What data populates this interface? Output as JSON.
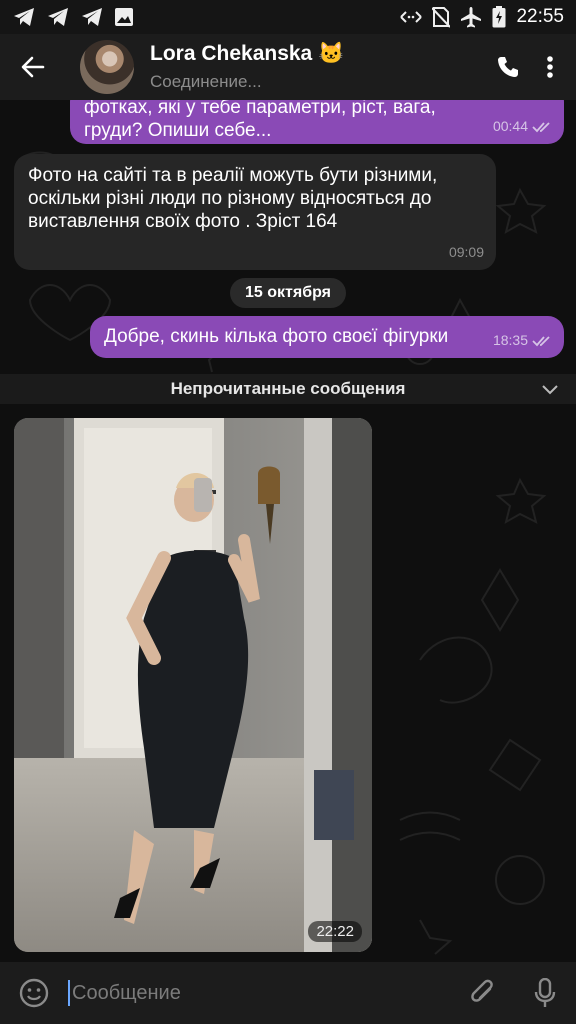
{
  "status_bar": {
    "time": "22:55",
    "left_icons": [
      "telegram-icon",
      "telegram-icon",
      "telegram-icon",
      "image-icon"
    ],
    "right_icons": [
      "data-sync-icon",
      "no-sim-icon",
      "airplane-mode-icon",
      "battery-charging-icon"
    ]
  },
  "header": {
    "name": "Lora Chekanska",
    "name_emoji": "🐱",
    "status": "Соединение..."
  },
  "messages": [
    {
      "direction": "out",
      "text": "фотках, які у тебе параметри, ріст, вага, груди? Опиши себе...",
      "time": "00:44",
      "read": true
    },
    {
      "direction": "in",
      "text": "Фото на сайті та в реалії можуть бути різними, оскільки різні люди по різному відносяться до виставлення своїх фото . Зріст 164",
      "time": "09:09"
    },
    {
      "direction": "out",
      "text": "Добре, скинь кілька фото своєї фігурки",
      "time": "18:35",
      "read": true
    }
  ],
  "date_divider": "15 октября",
  "unread_divider": "Непрочитанные сообщения",
  "photo_message": {
    "time": "22:22"
  },
  "composer": {
    "placeholder": "Сообщение"
  },
  "colors": {
    "outgoing_bubble": "#8a4ab6",
    "incoming_bubble": "#262626",
    "background": "#0f0f0f"
  }
}
